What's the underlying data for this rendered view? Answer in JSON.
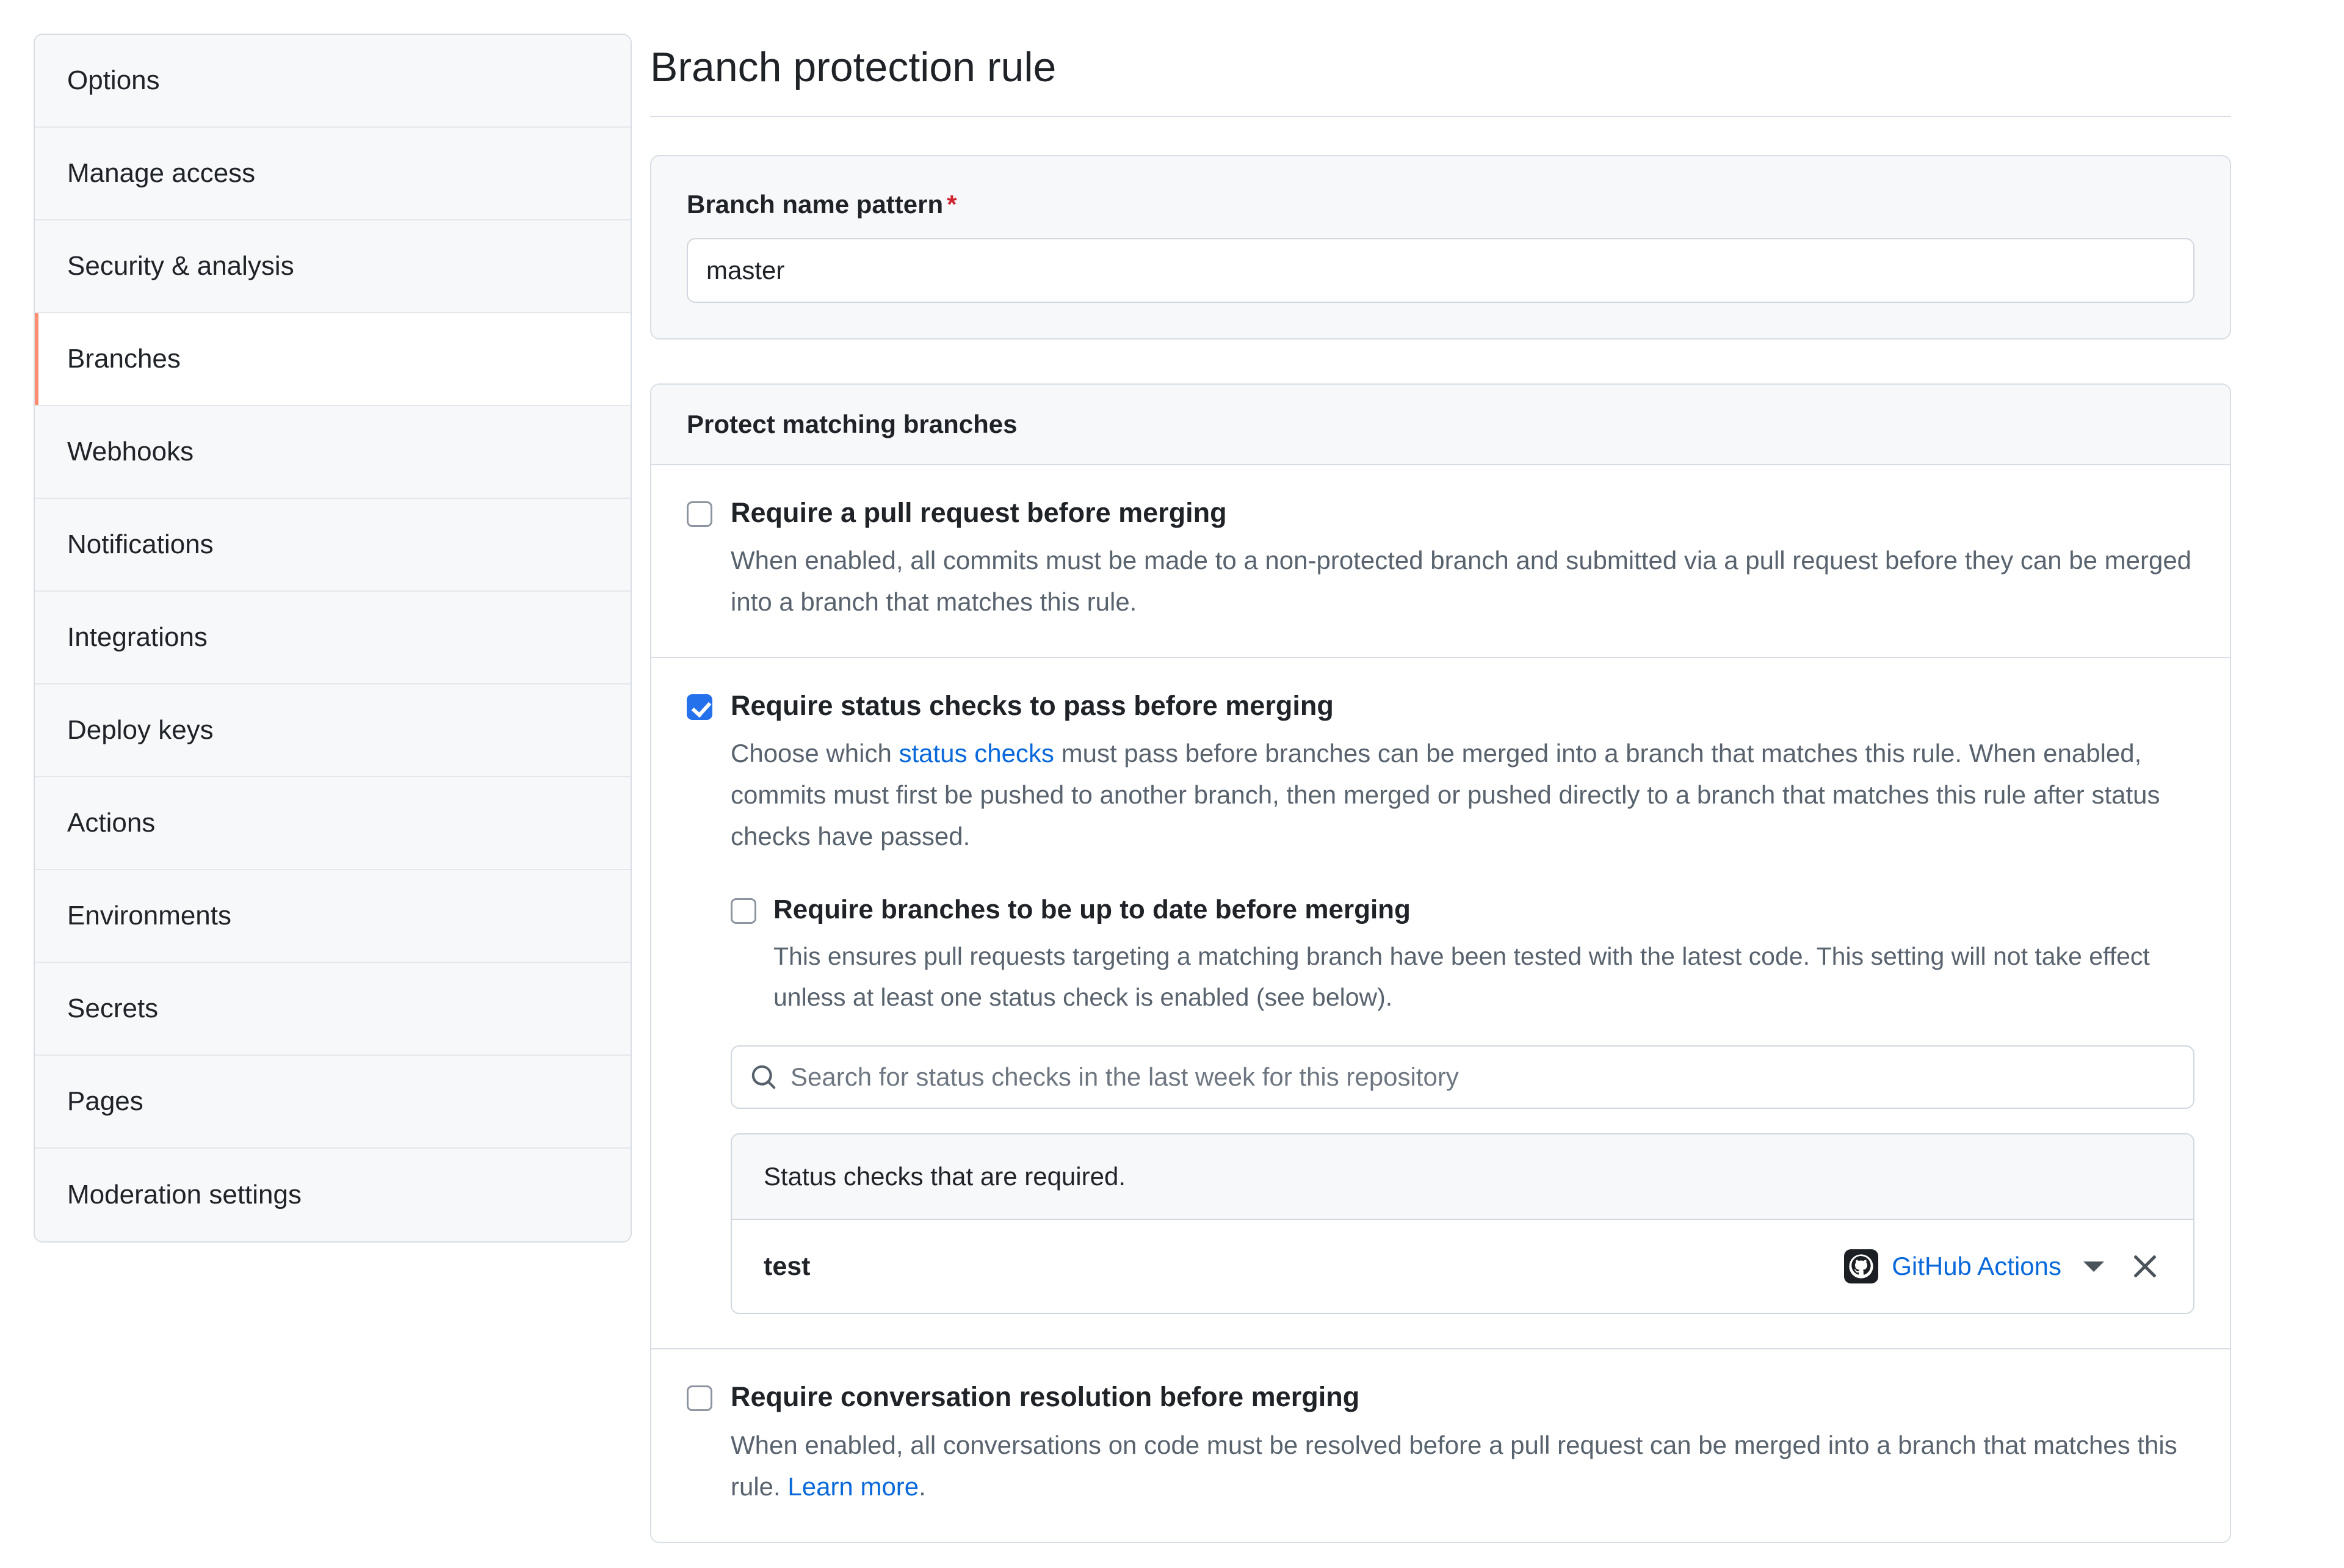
{
  "sidebar": {
    "items": [
      {
        "label": "Options",
        "active": false
      },
      {
        "label": "Manage access",
        "active": false
      },
      {
        "label": "Security & analysis",
        "active": false
      },
      {
        "label": "Branches",
        "active": true
      },
      {
        "label": "Webhooks",
        "active": false
      },
      {
        "label": "Notifications",
        "active": false
      },
      {
        "label": "Integrations",
        "active": false
      },
      {
        "label": "Deploy keys",
        "active": false
      },
      {
        "label": "Actions",
        "active": false
      },
      {
        "label": "Environments",
        "active": false
      },
      {
        "label": "Secrets",
        "active": false
      },
      {
        "label": "Pages",
        "active": false
      },
      {
        "label": "Moderation settings",
        "active": false
      }
    ]
  },
  "main": {
    "page_title": "Branch protection rule",
    "pattern": {
      "label": "Branch name pattern",
      "required_marker": "*",
      "value": "master",
      "placeholder": ""
    },
    "protect": {
      "header": "Protect matching branches",
      "rules": [
        {
          "id": "require-pull-request",
          "label": "Require a pull request before merging",
          "checked": false,
          "description": "When enabled, all commits must be made to a non-protected branch and submitted via a pull request before they can be merged into a branch that matches this rule."
        },
        {
          "id": "require-status-checks",
          "label": "Require status checks to pass before merging",
          "checked": true,
          "desc_before_link": "Choose which ",
          "desc_link": "status checks",
          "desc_after_link": " must pass before branches can be merged into a branch that matches this rule. When enabled, commits must first be pushed to another branch, then merged or pushed directly to a branch that matches this rule after status checks have passed."
        },
        {
          "id": "require-conversation-resolution",
          "label": "Require conversation resolution before merging",
          "checked": false,
          "desc_before_link": "When enabled, all conversations on code must be resolved before a pull request can be merged into a branch that matches this rule. ",
          "desc_link": "Learn more",
          "desc_after_link": "."
        }
      ],
      "nested_rule": {
        "id": "require-up-to-date",
        "label": "Require branches to be up to date before merging",
        "checked": false,
        "description": "This ensures pull requests targeting a matching branch have been tested with the latest code. This setting will not take effect unless at least one status check is enabled (see below)."
      },
      "search": {
        "placeholder": "Search for status checks in the last week for this repository",
        "value": "",
        "icon": "search-icon"
      },
      "checks_table": {
        "header": "Status checks that are required.",
        "rows": [
          {
            "name": "test",
            "source": "GitHub Actions",
            "source_icon": "github-octocat-icon",
            "caret_icon": "chevron-down-icon",
            "remove_icon": "close-icon"
          }
        ]
      }
    }
  },
  "colors": {
    "accent_blue": "#0969da",
    "checkbox_blue": "#2570eb",
    "active_border_orange": "#fd8c73",
    "required_red": "#cf222e",
    "muted_text": "#59636e",
    "panel_bg": "#f6f8fa",
    "border": "#d0d7de"
  }
}
